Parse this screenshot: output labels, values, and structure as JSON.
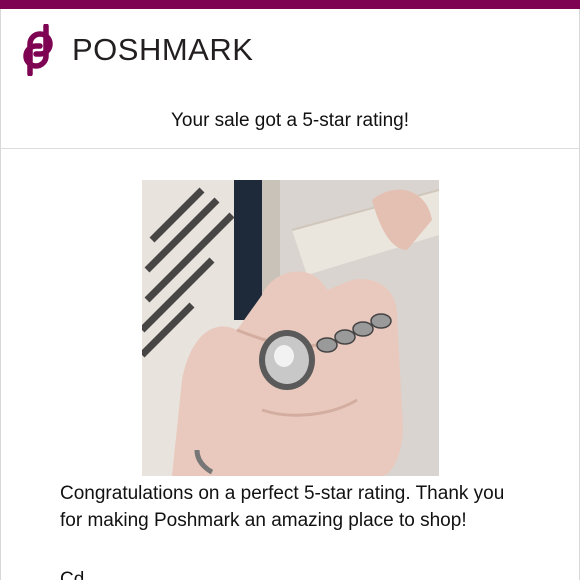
{
  "brand": {
    "name": "POSHMARK",
    "logo_icon": "poshmark-logo-icon",
    "bar_color": "#7f0353",
    "logo_color": "#7f0353"
  },
  "email": {
    "headline": "Your sale got a 5-star rating!",
    "product_image_icon": "product-photo-silver-rings",
    "body": "Congratulations on a perfect 5-star rating. Thank you for making Poshmark an amazing place to shop!",
    "signoff": "Cd..."
  }
}
